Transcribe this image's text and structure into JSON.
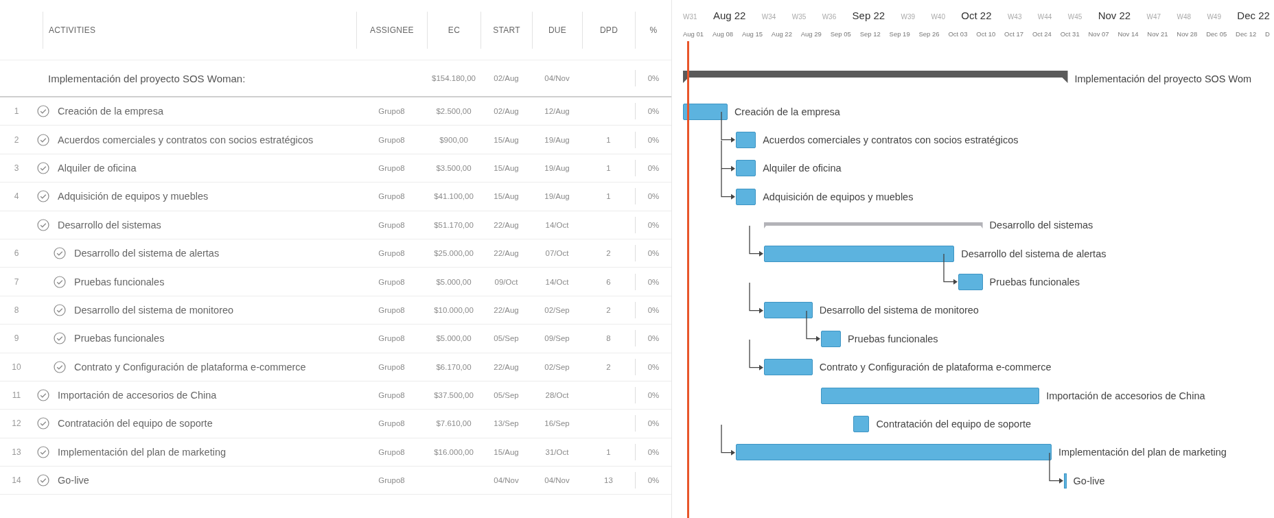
{
  "table": {
    "columns": [
      "ACTIVITIES",
      "ASSIGNEE",
      "EC",
      "START",
      "DUE",
      "DPD",
      "%"
    ],
    "rows": [
      {
        "kind": "summary",
        "name": "Implementación del proyecto SOS Woman:",
        "ec": "$154.180,00",
        "start": "02/Aug",
        "due": "04/Nov",
        "pct": "0%",
        "bar_label": "Implementación del proyecto SOS Wom",
        "linked": false
      },
      {
        "kind": "task",
        "num": "1",
        "name": "Creación de la empresa",
        "assignee": "Grupo8",
        "ec": "$2.500,00",
        "start": "02/Aug",
        "due": "12/Aug",
        "pct": "0%",
        "bar_label": "Creación de la empresa",
        "linked": false
      },
      {
        "kind": "task",
        "num": "2",
        "name": "Acuerdos comerciales y contratos con socios estratégicos",
        "assignee": "Grupo8",
        "ec": "$900,00",
        "start": "15/Aug",
        "due": "19/Aug",
        "dpd": "1",
        "pct": "0%",
        "bar_label": "Acuerdos comerciales y contratos con socios estratégicos",
        "linked": true
      },
      {
        "kind": "task",
        "num": "3",
        "name": "Alquiler de oficina",
        "assignee": "Grupo8",
        "ec": "$3.500,00",
        "start": "15/Aug",
        "due": "19/Aug",
        "dpd": "1",
        "pct": "0%",
        "bar_label": "Alquiler de oficina",
        "linked": true
      },
      {
        "kind": "task",
        "num": "4",
        "name": "Adquisición de equipos y muebles",
        "assignee": "Grupo8",
        "ec": "$41.100,00",
        "start": "15/Aug",
        "due": "19/Aug",
        "dpd": "1",
        "pct": "0%",
        "bar_label": "Adquisición de equipos y muebles",
        "linked": true
      },
      {
        "kind": "group",
        "name": "Desarrollo del sistemas",
        "assignee": "Grupo8",
        "ec": "$51.170,00",
        "start": "22/Aug",
        "due": "14/Oct",
        "pct": "0%",
        "bar_label": "Desarrollo del sistemas",
        "linked": false,
        "children": [
          {
            "kind": "task",
            "num": "6",
            "name": "Desarrollo del sistema de alertas",
            "assignee": "Grupo8",
            "ec": "$25.000,00",
            "start": "22/Aug",
            "due": "07/Oct",
            "dpd": "2",
            "pct": "0%",
            "bar_label": "Desarrollo del sistema de alertas",
            "linked": true
          },
          {
            "kind": "task",
            "num": "7",
            "name": "Pruebas funcionales",
            "assignee": "Grupo8",
            "ec": "$5.000,00",
            "start": "09/Oct",
            "due": "14/Oct",
            "dpd": "6",
            "pct": "0%",
            "bar_label": "Pruebas funcionales",
            "linked": true
          },
          {
            "kind": "task",
            "num": "8",
            "name": "Desarrollo del sistema de monitoreo",
            "assignee": "Grupo8",
            "ec": "$10.000,00",
            "start": "22/Aug",
            "due": "02/Sep",
            "dpd": "2",
            "pct": "0%",
            "bar_label": "Desarrollo del sistema de monitoreo",
            "linked": true
          },
          {
            "kind": "task",
            "num": "9",
            "name": "Pruebas funcionales",
            "assignee": "Grupo8",
            "ec": "$5.000,00",
            "start": "05/Sep",
            "due": "09/Sep",
            "dpd": "8",
            "pct": "0%",
            "bar_label": "Pruebas funcionales",
            "linked": true
          },
          {
            "kind": "task",
            "num": "10",
            "name": "Contrato y Configuración de plataforma e-commerce",
            "assignee": "Grupo8",
            "ec": "$6.170,00",
            "start": "22/Aug",
            "due": "02/Sep",
            "dpd": "2",
            "pct": "0%",
            "bar_label": "Contrato y Configuración de plataforma e-commerce",
            "linked": true
          }
        ]
      },
      {
        "kind": "task",
        "num": "11",
        "name": "Importación de accesorios de China",
        "assignee": "Grupo8",
        "ec": "$37.500,00",
        "start": "05/Sep",
        "due": "28/Oct",
        "pct": "0%",
        "bar_label": "Importación de accesorios de China",
        "linked": false
      },
      {
        "kind": "task",
        "num": "12",
        "name": "Contratación del equipo de soporte",
        "assignee": "Grupo8",
        "ec": "$7.610,00",
        "start": "13/Sep",
        "due": "16/Sep",
        "pct": "0%",
        "bar_label": "Contratación del equipo de soporte",
        "linked": false
      },
      {
        "kind": "task",
        "num": "13",
        "name": "Implementación del plan de marketing",
        "assignee": "Grupo8",
        "ec": "$16.000,00",
        "start": "15/Aug",
        "due": "31/Oct",
        "dpd": "1",
        "pct": "0%",
        "bar_label": "Implementación del plan de marketing",
        "linked": true
      },
      {
        "kind": "milestone",
        "num": "14",
        "name": "Go-live",
        "assignee": "Grupo8",
        "start": "04/Nov",
        "due": "04/Nov",
        "dpd": "13",
        "pct": "0%",
        "bar_label": "Go-live",
        "linked": true
      }
    ]
  },
  "timeline": {
    "periods": [
      {
        "label": "W31",
        "kind": "week"
      },
      {
        "label": "Aug 22",
        "kind": "month"
      },
      {
        "label": "W34",
        "kind": "week"
      },
      {
        "label": "W35",
        "kind": "week"
      },
      {
        "label": "W36",
        "kind": "week"
      },
      {
        "label": "Sep 22",
        "kind": "month"
      },
      {
        "label": "W39",
        "kind": "week"
      },
      {
        "label": "W40",
        "kind": "week"
      },
      {
        "label": "Oct 22",
        "kind": "month"
      },
      {
        "label": "W43",
        "kind": "week"
      },
      {
        "label": "W44",
        "kind": "week"
      },
      {
        "label": "W45",
        "kind": "week"
      },
      {
        "label": "Nov 22",
        "kind": "month"
      },
      {
        "label": "W47",
        "kind": "week"
      },
      {
        "label": "W48",
        "kind": "week"
      },
      {
        "label": "W49",
        "kind": "week"
      },
      {
        "label": "Dec 22",
        "kind": "month"
      }
    ],
    "weeks": [
      "Aug 01",
      "Aug 08",
      "Aug 15",
      "Aug 22",
      "Aug 29",
      "Sep 05",
      "Sep 12",
      "Sep 19",
      "Sep 26",
      "Oct 03",
      "Oct 10",
      "Oct 17",
      "Oct 24",
      "Oct 31",
      "Nov 07",
      "Nov 14",
      "Nov 21",
      "Nov 28",
      "Dec 05",
      "Dec 12",
      "D"
    ]
  }
}
